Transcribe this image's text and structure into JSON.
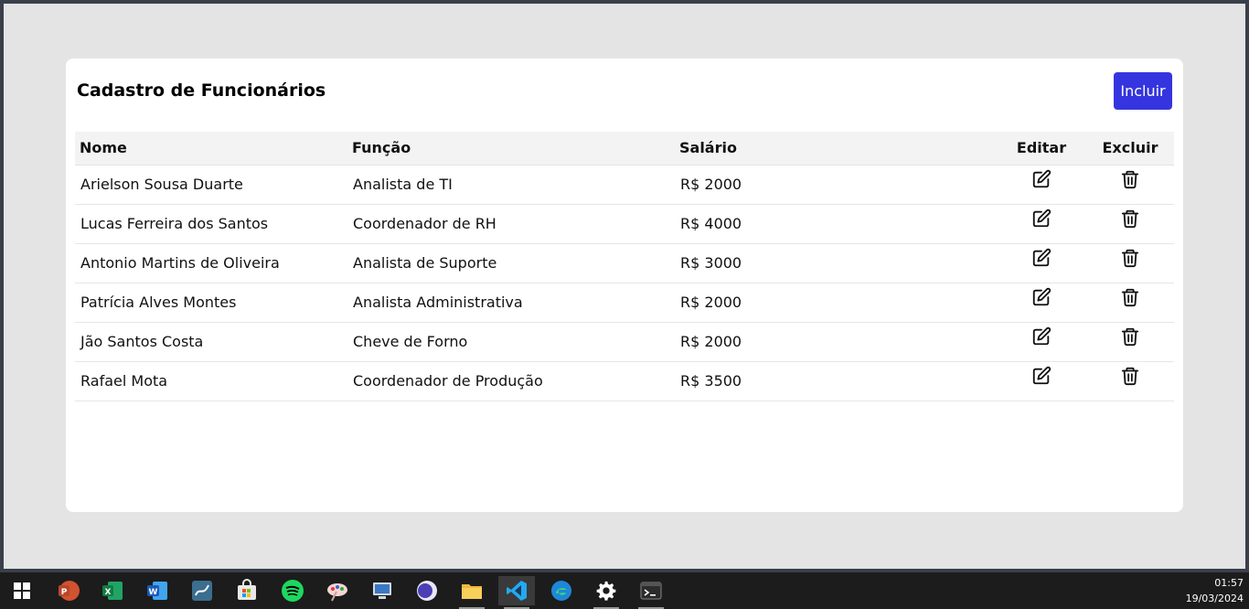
{
  "card": {
    "title": "Cadastro de Funcionários",
    "add_button": "Incluir"
  },
  "table": {
    "headers": {
      "name": "Nome",
      "role": "Função",
      "salary": "Salário",
      "edit": "Editar",
      "delete": "Excluir"
    },
    "rows": [
      {
        "name": "Arielson Sousa Duarte",
        "role": "Analista de TI",
        "salary": "R$ 2000"
      },
      {
        "name": "Lucas Ferreira dos Santos",
        "role": "Coordenador de RH",
        "salary": "R$ 4000"
      },
      {
        "name": "Antonio Martins de Oliveira",
        "role": "Analista de Suporte",
        "salary": "R$ 3000"
      },
      {
        "name": "Patrícia Alves Montes",
        "role": "Analista Administrativa",
        "salary": "R$ 2000"
      },
      {
        "name": "Jão Santos Costa",
        "role": "Cheve de Forno",
        "salary": "R$ 2000"
      },
      {
        "name": "Rafael Mota",
        "role": "Coordenador de Produção",
        "salary": "R$ 3500"
      }
    ]
  },
  "taskbar": {
    "apps": [
      "windows-start-icon",
      "powerpoint-icon",
      "excel-icon",
      "word-icon",
      "mysql-workbench-icon",
      "microsoft-store-icon",
      "spotify-icon",
      "paint-icon",
      "remote-desktop-icon",
      "eclipse-icon",
      "file-explorer-icon",
      "vscode-icon",
      "edge-icon",
      "settings-icon",
      "terminal-icon"
    ],
    "time": "01:57",
    "date": "19/03/2024"
  },
  "colors": {
    "accent": "#3535e0",
    "page_bg": "#e4e4e4",
    "card_bg": "#ffffff",
    "header_row_bg": "#f3f3f3",
    "taskbar_bg": "#1c1c1c"
  }
}
